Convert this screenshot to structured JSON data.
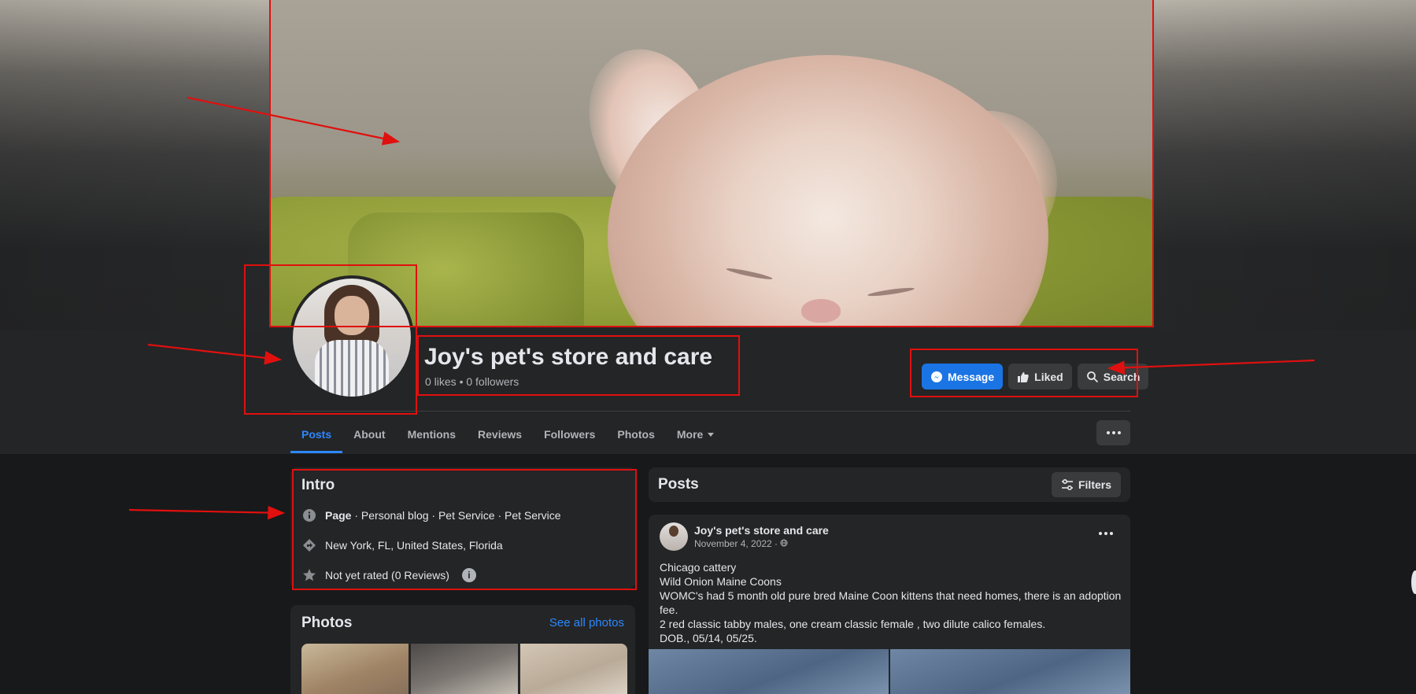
{
  "page": {
    "name": "Joy's pet's store and care",
    "stats": "0 likes • 0 followers"
  },
  "actions": {
    "message": "Message",
    "liked": "Liked",
    "search": "Search"
  },
  "tabs": [
    {
      "label": "Posts",
      "active": true
    },
    {
      "label": "About"
    },
    {
      "label": "Mentions"
    },
    {
      "label": "Reviews"
    },
    {
      "label": "Followers"
    },
    {
      "label": "Photos"
    },
    {
      "label": "More"
    }
  ],
  "intro": {
    "title": "Intro",
    "category_bold": "Page",
    "category_rest": " · Personal blog · Pet Service · Pet Service",
    "location": "New York, FL, United States, Florida",
    "rating": "Not yet rated (0 Reviews)",
    "icons": [
      "info-icon",
      "location-icon",
      "star-icon"
    ]
  },
  "photos": {
    "title": "Photos",
    "see_all": "See all photos"
  },
  "posts": {
    "title": "Posts",
    "filters": "Filters"
  },
  "post": {
    "author": "Joy's pet's store and care",
    "date": "November 4, 2022 · ",
    "lines": [
      "Chicago cattery",
      "Wild Onion Maine Coons",
      "WOMC's had 5 month old  pure bred Maine Coon kittens that need homes, there is an adoption",
      "fee.",
      "2 red classic tabby males, one cream classic female , two dilute calico females.",
      "DOB., 05/14, 05/25."
    ]
  },
  "colors": {
    "accent": "#2d88ff",
    "primary_button": "#1b74e4",
    "annotation": "#e0100f",
    "background": "#18191a",
    "card": "#242526"
  }
}
